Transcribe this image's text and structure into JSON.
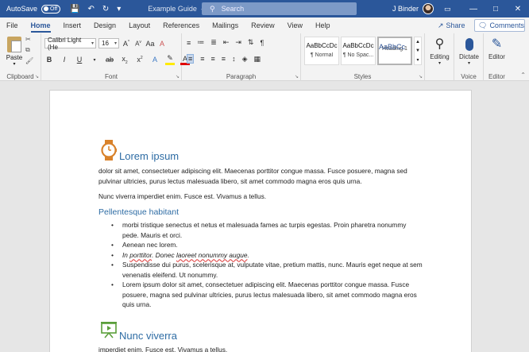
{
  "titlebar": {
    "autosave_label": "AutoSave",
    "autosave_state": "Off",
    "doc_title": "Example Guide",
    "search_placeholder": "Search",
    "user_name": "J Binder"
  },
  "tabs": [
    "File",
    "Home",
    "Insert",
    "Design",
    "Layout",
    "References",
    "Mailings",
    "Review",
    "View",
    "Help"
  ],
  "active_tab": "Home",
  "share_label": "Share",
  "comments_label": "Comments",
  "ribbon": {
    "clipboard": {
      "paste_label": "Paste",
      "group_label": "Clipboard"
    },
    "font": {
      "font_name": "Calibri Light (He",
      "font_size": "16",
      "group_label": "Font"
    },
    "paragraph": {
      "group_label": "Paragraph"
    },
    "styles": {
      "group_label": "Styles",
      "items": [
        {
          "sample": "AaBbCcDc",
          "name": "¶ Normal"
        },
        {
          "sample": "AaBbCcDc",
          "name": "¶ No Spac..."
        },
        {
          "sample": "AaBbCc",
          "name": "Heading 1"
        }
      ]
    },
    "editing": {
      "label": "Editing"
    },
    "voice": {
      "dictate_label": "Dictate",
      "group_label": "Voice"
    },
    "editor": {
      "editor_label": "Editor",
      "group_label": "Editor"
    }
  },
  "document": {
    "heading1": "Lorem ipsum",
    "para1": "dolor sit amet, consectetuer adipiscing elit. Maecenas porttitor congue massa. Fusce posuere, magna sed pulvinar ultricies, purus lectus malesuada libero, sit amet commodo magna eros quis urna.",
    "para2": "Nunc viverra imperdiet enim. Fusce est. Vivamus a tellus.",
    "heading2": "Pellentesque habitant",
    "bullets": [
      "morbi tristique senectus et netus et malesuada fames ac turpis egestas. Proin pharetra nonummy pede. Mauris et orci.",
      "Aenean nec lorem.",
      "In porttitor. Donec laoreet nonummy augue.",
      "Suspendisse dui purus, scelerisque at, vulputate vitae, pretium mattis, nunc. Mauris eget neque at sem venenatis eleifend. Ut nonummy.",
      "Lorem ipsum dolor sit amet, consectetuer adipiscing elit. Maecenas porttitor congue massa. Fusce posuere, magna sed pulvinar ultricies, purus lectus malesuada libero, sit amet commodo magna eros quis urna."
    ],
    "bullet3_parts": {
      "a": "In ",
      "b": "porttitor",
      "c": ". Donec ",
      "d": "laoreet nonummy augue",
      "e": "."
    },
    "heading3": "Nunc viverra",
    "para3": "imperdiet enim. Fusce est. Vivamus a tellus."
  },
  "colors": {
    "titlebar": "#2b579a",
    "heading": "#2e6ca4",
    "icon_orange": "#d9822b",
    "icon_green": "#5a9e3a"
  }
}
